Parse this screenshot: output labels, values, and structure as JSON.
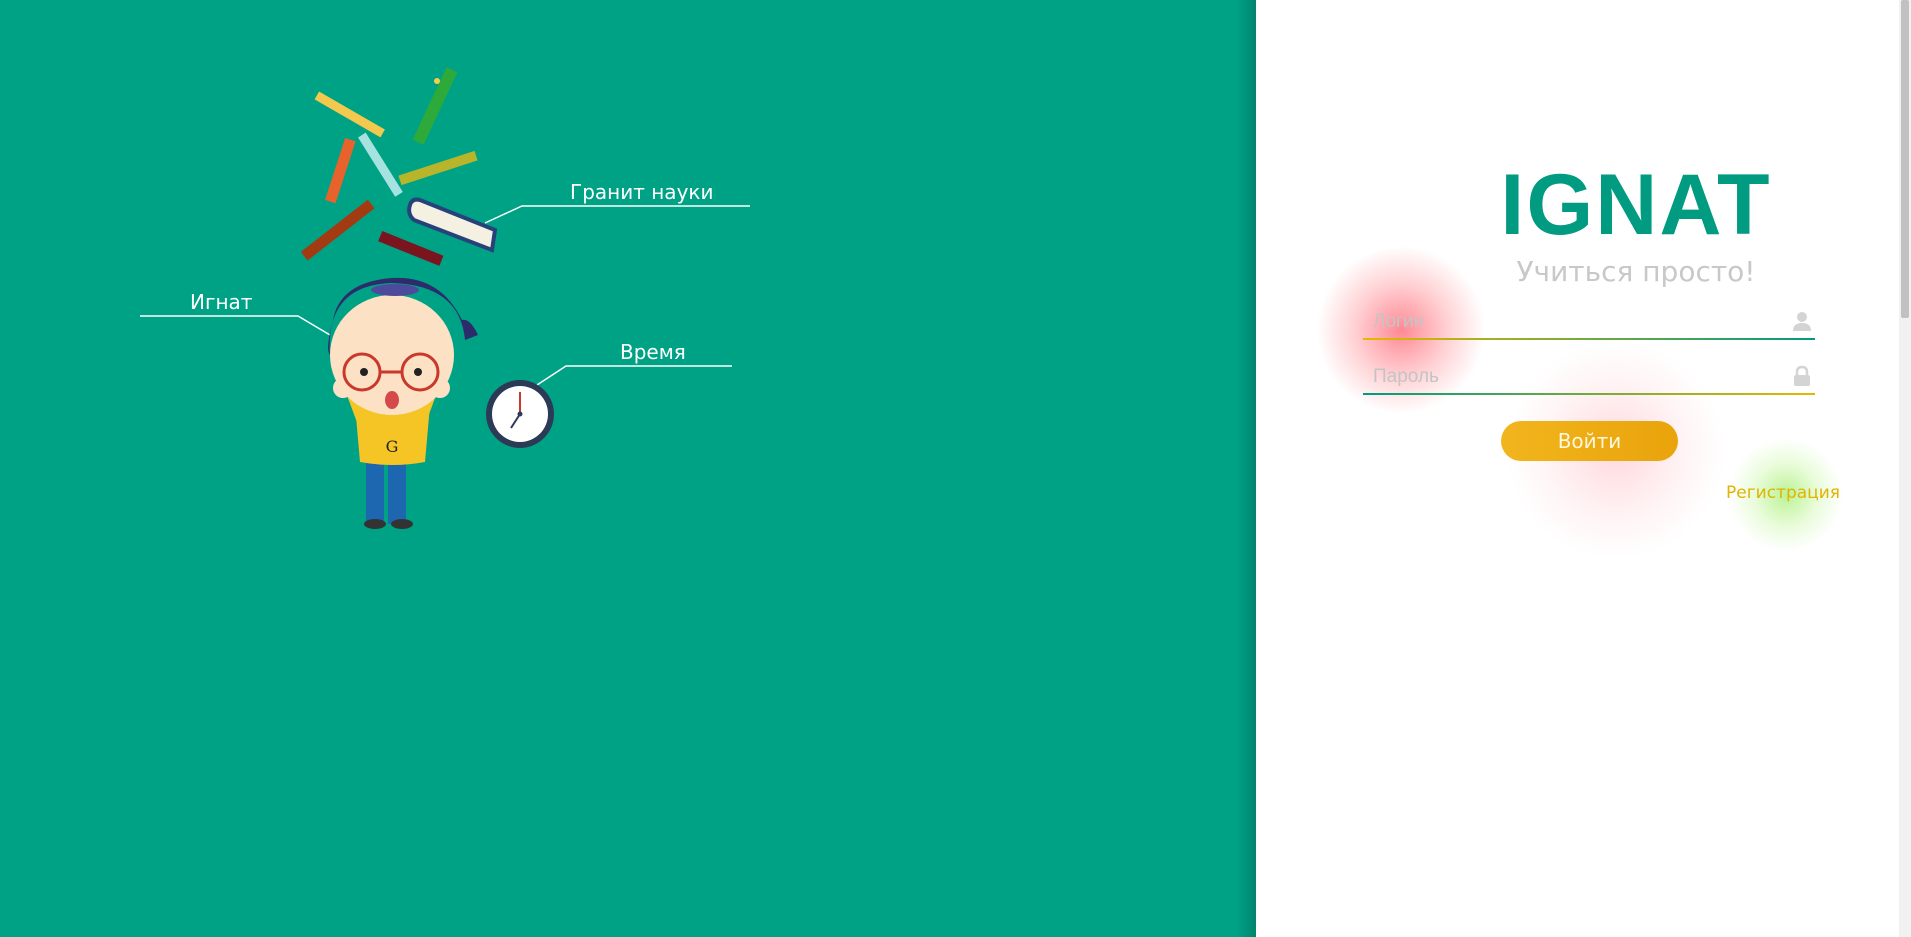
{
  "illustration": {
    "labels": {
      "granite": "Гранит науки",
      "ignat": "Игнат",
      "time": "Время"
    },
    "shirt_letter": "G"
  },
  "login_form": {
    "brand": "IGNAT",
    "tagline": "Учиться просто!",
    "login_placeholder": "Логин",
    "password_placeholder": "Пароль",
    "submit_label": "Войти",
    "register_label": "Регистрация"
  },
  "colors": {
    "left_panel": "#00a286",
    "brand": "#009b80",
    "button": "#efaf15",
    "register_link": "#e0b400"
  },
  "icons": {
    "login": "user-icon",
    "password": "lock-icon"
  }
}
